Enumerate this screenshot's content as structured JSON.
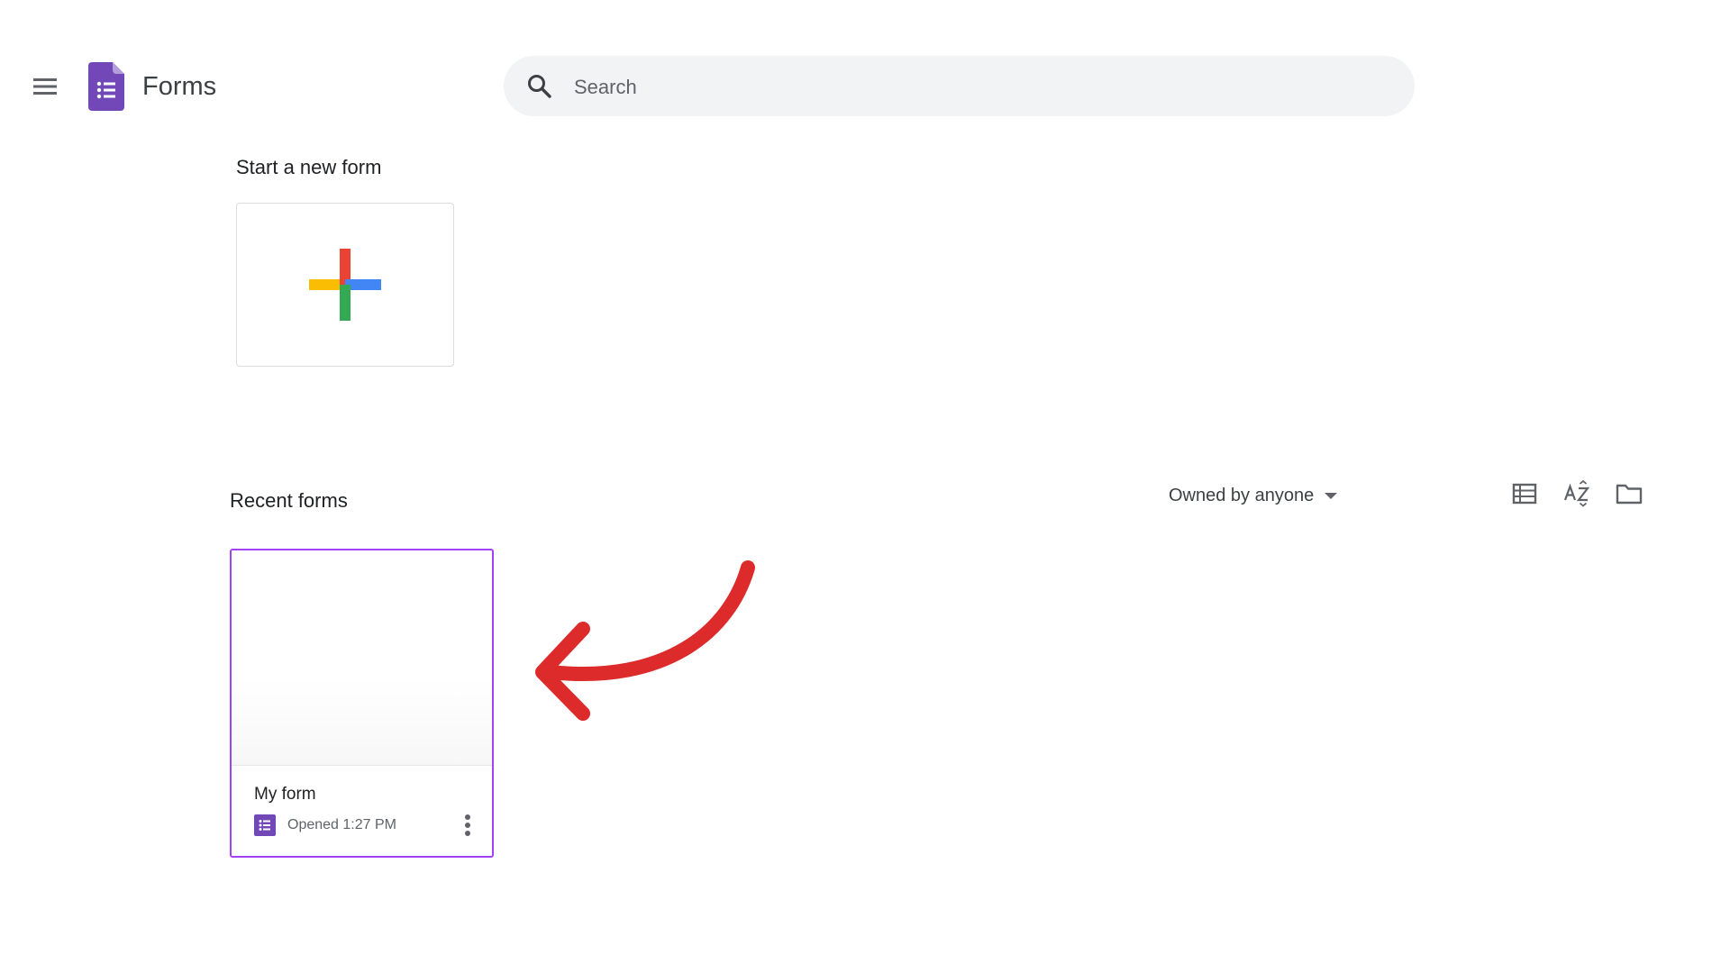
{
  "header": {
    "menu_icon": "hamburger-menu-icon",
    "logo_icon": "google-forms-logo-icon",
    "app_title": "Forms",
    "search": {
      "icon": "search-icon",
      "placeholder": "Search",
      "value": ""
    }
  },
  "start_section": {
    "title": "Start a new form",
    "blank_tile_icon": "plus-icon",
    "plus_colors": {
      "red": "#ea4335",
      "blue": "#4285f4",
      "yellow": "#fbbc04",
      "green": "#34a853"
    }
  },
  "recent_section": {
    "title": "Recent forms",
    "owner_filter": "Owned by anyone",
    "tools": {
      "list_view_icon": "list-view-icon",
      "sort_icon": "sort-az-icon",
      "folder_icon": "folder-icon"
    },
    "forms": [
      {
        "name": "My form",
        "opened": "Opened 1:27 PM",
        "icon": "forms-small-icon",
        "more_icon": "more-vert-icon"
      }
    ]
  },
  "annotation": {
    "arrow_icon": "red-curved-arrow-icon",
    "arrow_color": "#dd2a2a"
  },
  "colors": {
    "forms_purple": "#7248b9",
    "selected_border": "#a142f4"
  }
}
